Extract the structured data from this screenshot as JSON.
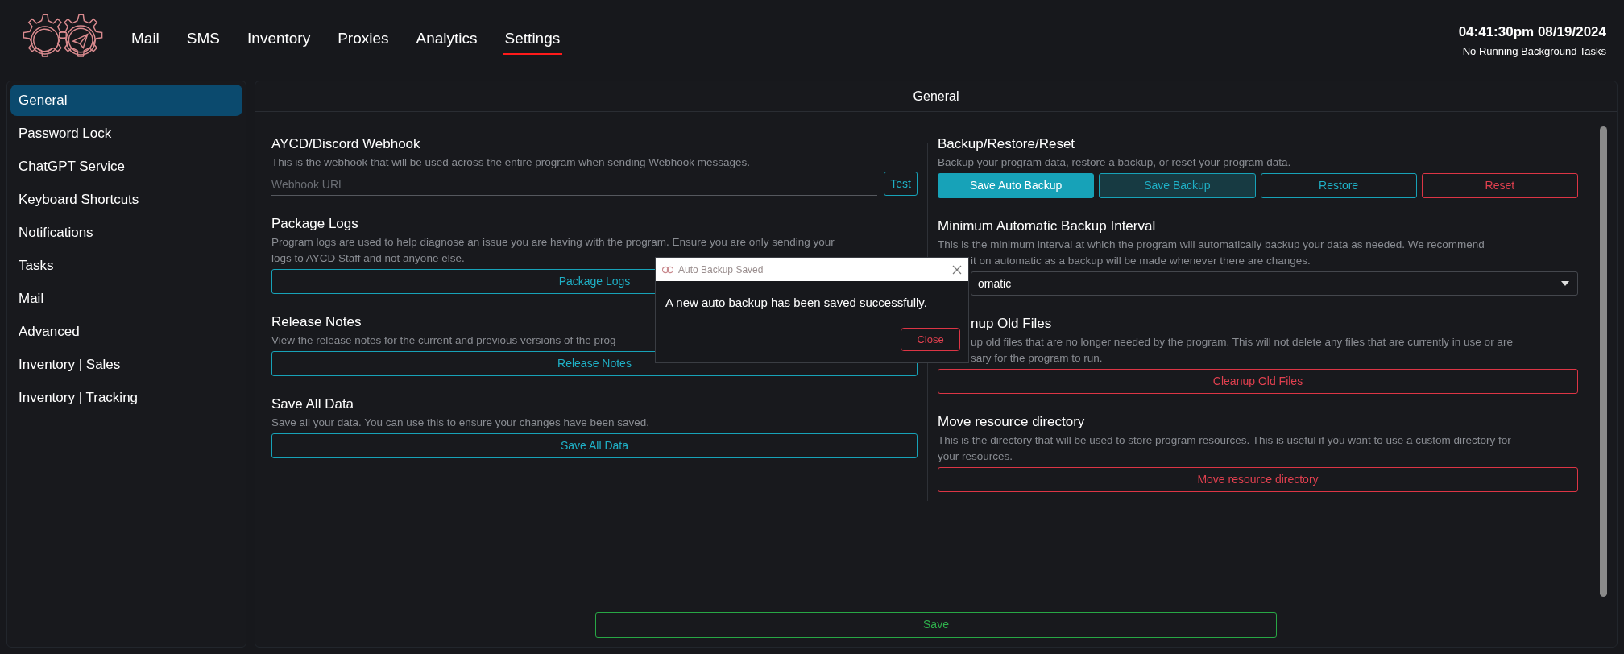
{
  "header": {
    "nav": [
      {
        "label": "Mail",
        "selected": false
      },
      {
        "label": "SMS",
        "selected": false
      },
      {
        "label": "Inventory",
        "selected": false
      },
      {
        "label": "Proxies",
        "selected": false
      },
      {
        "label": "Analytics",
        "selected": false
      },
      {
        "label": "Settings",
        "selected": true
      }
    ],
    "clock": "04:41:30pm 08/19/2024",
    "status": "No Running Background Tasks"
  },
  "sidebar": {
    "items": [
      {
        "label": "General",
        "selected": true
      },
      {
        "label": "Password Lock",
        "selected": false
      },
      {
        "label": "ChatGPT Service",
        "selected": false
      },
      {
        "label": "Keyboard Shortcuts",
        "selected": false
      },
      {
        "label": "Notifications",
        "selected": false
      },
      {
        "label": "Tasks",
        "selected": false
      },
      {
        "label": "Mail",
        "selected": false
      },
      {
        "label": "Advanced",
        "selected": false
      },
      {
        "label": "Inventory | Sales",
        "selected": false
      },
      {
        "label": "Inventory | Tracking",
        "selected": false
      }
    ]
  },
  "panel": {
    "title": "General",
    "left_sections": [
      {
        "title": "AYCD/Discord Webhook",
        "lines": [
          "This is the webhook that will be used across the entire program when sending Webhook messages."
        ],
        "kind": "input",
        "placeholder": "Webhook URL",
        "button": "Test"
      },
      {
        "title": "Package Logs",
        "lines": [
          "Program logs are used to help diagnose an issue you are having with the program. Ensure you are only sending your",
          "logs to AYCD Staff and not anyone else."
        ],
        "kind": "buttons",
        "buttons": [
          {
            "label": "Package Logs",
            "kind": "outline"
          }
        ]
      },
      {
        "title": "Release Notes",
        "lines": [
          "View the release notes for the current and previous versions of the prog"
        ],
        "kind": "buttons",
        "buttons": [
          {
            "label": "Release Notes",
            "kind": "outline"
          }
        ]
      },
      {
        "title": "Save All Data",
        "lines": [
          "Save all your data. You can use this to ensure your changes have been saved."
        ],
        "kind": "buttons",
        "buttons": [
          {
            "label": "Save All Data",
            "kind": "outline"
          }
        ]
      }
    ],
    "right_sections": [
      {
        "title": "Backup/Restore/Reset",
        "lines": [
          "Backup your program data, restore a backup, or reset your program data."
        ],
        "kind": "buttons",
        "buttons": [
          {
            "label": "Save Auto Backup",
            "kind": "primary"
          },
          {
            "label": "Save Backup",
            "kind": "secondary"
          },
          {
            "label": "Restore",
            "kind": "outline"
          },
          {
            "label": "Reset",
            "kind": "danger"
          }
        ]
      },
      {
        "title": "Minimum Automatic Backup Interval",
        "lines": [
          "This is the minimum interval at which the program will automatically backup your data as needed. We recommend",
          "it on automatic as a backup will be made whenever there are changes."
        ],
        "kind": "select",
        "value": "omatic"
      },
      {
        "title": "nup Old Files",
        "lines": [
          "up old files that are no longer needed by the program. This will not delete any files that are currently in use or are",
          "sary for the program to run."
        ],
        "kind": "buttons",
        "buttons": [
          {
            "label": "Cleanup Old Files",
            "kind": "danger"
          }
        ]
      },
      {
        "title": "Move resource directory",
        "lines": [
          "This is the directory that will be used to store program resources. This is useful if you want to use a custom directory for",
          "your resources."
        ],
        "kind": "buttons",
        "buttons": [
          {
            "label": "Move resource directory",
            "kind": "danger"
          }
        ]
      }
    ],
    "save_button": "Save"
  },
  "dialog": {
    "title": "Auto Backup Saved",
    "message": "A new auto backup has been saved successfully.",
    "button": "Close"
  }
}
